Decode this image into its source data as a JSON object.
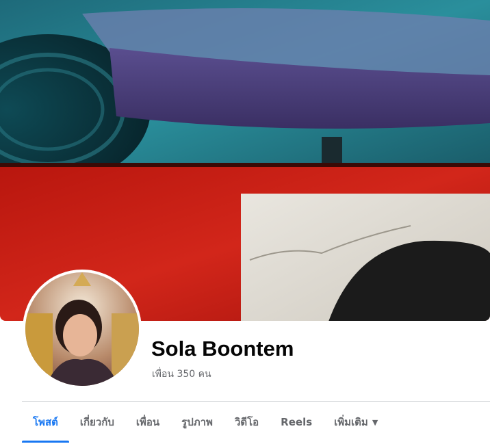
{
  "profile": {
    "name": "Sola Boontem",
    "friends_text": "เพื่อน 350 คน"
  },
  "cover": {
    "description_icon": "cover-photo"
  },
  "tabs": [
    {
      "label": "โพสต์",
      "active": true
    },
    {
      "label": "เกี่ยวกับ",
      "active": false
    },
    {
      "label": "เพื่อน",
      "active": false
    },
    {
      "label": "รูปภาพ",
      "active": false
    },
    {
      "label": "วิดีโอ",
      "active": false
    },
    {
      "label": "Reels",
      "active": false
    },
    {
      "label": "เพิ่มเติม",
      "active": false
    }
  ],
  "more_icon": "caret-down-icon",
  "colors": {
    "accent": "#1877f2",
    "muted_text": "#65676b",
    "name_text": "#050505"
  }
}
